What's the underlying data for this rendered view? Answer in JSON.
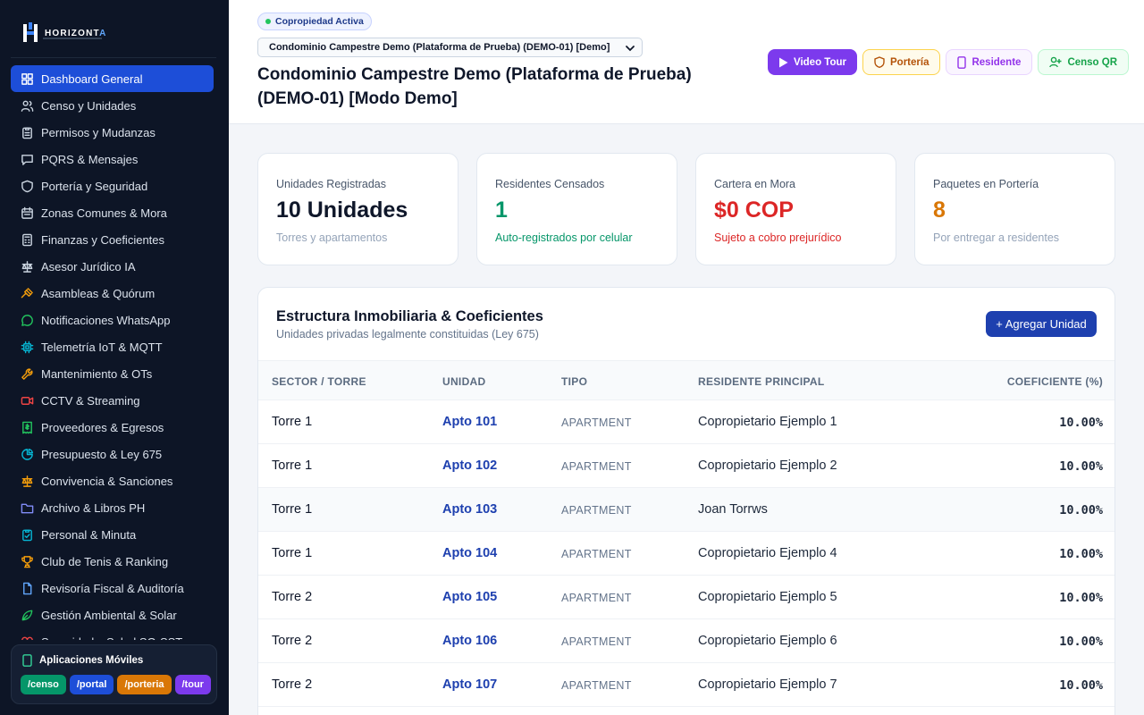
{
  "brand": {
    "name": "HORIZONT",
    "name_accent": "A"
  },
  "sidebar": {
    "items": [
      {
        "label": "Dashboard General",
        "icon": "dashboard-icon",
        "color": "#ffffff"
      },
      {
        "label": "Censo y Unidades",
        "icon": "users-icon",
        "color": "#cbd5e1"
      },
      {
        "label": "Permisos y Mudanzas",
        "icon": "clipboard-icon",
        "color": "#cbd5e1"
      },
      {
        "label": "PQRS & Mensajes",
        "icon": "message-icon",
        "color": "#cbd5e1"
      },
      {
        "label": "Portería y Seguridad",
        "icon": "shield-icon",
        "color": "#cbd5e1"
      },
      {
        "label": "Zonas Comunes & Mora",
        "icon": "calendar-icon",
        "color": "#cbd5e1"
      },
      {
        "label": "Finanzas y Coeficientes",
        "icon": "calculator-icon",
        "color": "#cbd5e1"
      },
      {
        "label": "Asesor Jurídico IA",
        "icon": "scale-icon",
        "color": "#cbd5e1"
      },
      {
        "label": "Asambleas & Quórum",
        "icon": "gavel-icon",
        "color": "#f59e0b"
      },
      {
        "label": "Notificaciones WhatsApp",
        "icon": "whatsapp-icon",
        "color": "#22c55e"
      },
      {
        "label": "Telemetría IoT & MQTT",
        "icon": "chip-icon",
        "color": "#06b6d4"
      },
      {
        "label": "Mantenimiento & OTs",
        "icon": "wrench-icon",
        "color": "#f59e0b"
      },
      {
        "label": "CCTV & Streaming",
        "icon": "video-icon",
        "color": "#ef4444"
      },
      {
        "label": "Proveedores & Egresos",
        "icon": "receipt-icon",
        "color": "#22c55e"
      },
      {
        "label": "Presupuesto & Ley 675",
        "icon": "pie-chart-icon",
        "color": "#06b6d4"
      },
      {
        "label": "Convivencia & Sanciones",
        "icon": "balance-icon",
        "color": "#f59e0b"
      },
      {
        "label": "Archivo & Libros PH",
        "icon": "folder-icon",
        "color": "#818cf8"
      },
      {
        "label": "Personal & Minuta",
        "icon": "clipboard-check-icon",
        "color": "#06b6d4"
      },
      {
        "label": "Club de Tenis & Ranking",
        "icon": "trophy-icon",
        "color": "#f59e0b"
      },
      {
        "label": "Revisoría Fiscal & Auditoría",
        "icon": "file-icon",
        "color": "#60a5fa"
      },
      {
        "label": "Gestión Ambiental & Solar",
        "icon": "leaf-icon",
        "color": "#22c55e"
      },
      {
        "label": "Seguridad y Salud SG-SST",
        "icon": "heart-icon",
        "color": "#ef4444"
      }
    ],
    "apps": {
      "title": "Aplicaciones Móviles",
      "links": [
        {
          "label": "/censo",
          "color": "#059669"
        },
        {
          "label": "/portal",
          "color": "#1d4ed8"
        },
        {
          "label": "/porteria",
          "color": "#d97706"
        },
        {
          "label": "/tour",
          "color": "#7c3aed"
        }
      ]
    }
  },
  "header": {
    "badge": "Copropiedad Activa",
    "selector_value": "Condominio Campestre Demo (Plataforma de Prueba) (DEMO-01) [Demo]",
    "title": "Condominio Campestre Demo (Plataforma de Prueba) (DEMO-01) [Modo Demo]",
    "buttons": {
      "tour": "Video Tour",
      "porteria": "Portería",
      "residente": "Residente",
      "censo": "Censo QR"
    }
  },
  "kpis": [
    {
      "label": "Unidades Registradas",
      "value": "10 Unidades",
      "sub": "Torres y apartamentos",
      "value_color": "#0f172a",
      "sub_color": "#94a3b8"
    },
    {
      "label": "Residentes Censados",
      "value": "1",
      "sub": "Auto-registrados por celular",
      "value_color": "#059669",
      "sub_color": "#059669"
    },
    {
      "label": "Cartera en Mora",
      "value": "$0 COP",
      "sub": "Sujeto a cobro prejurídico",
      "value_color": "#dc2626",
      "sub_color": "#dc2626"
    },
    {
      "label": "Paquetes en Portería",
      "value": "8",
      "sub": "Por entregar a residentes",
      "value_color": "#d97706",
      "sub_color": "#94a3b8"
    }
  ],
  "structure": {
    "title": "Estructura Inmobiliaria & Coeficientes",
    "subtitle": "Unidades privadas legalmente constituidas (Ley 675)",
    "add_button": "+ Agregar Unidad",
    "columns": [
      "SECTOR / TORRE",
      "UNIDAD",
      "TIPO",
      "RESIDENTE PRINCIPAL",
      "COEFICIENTE (%)"
    ],
    "rows": [
      {
        "sector": "Torre 1",
        "unit": "Apto 101",
        "type": "APARTMENT",
        "resident": "Copropietario Ejemplo 1",
        "coef": "10.00%"
      },
      {
        "sector": "Torre 1",
        "unit": "Apto 102",
        "type": "APARTMENT",
        "resident": "Copropietario Ejemplo 2",
        "coef": "10.00%"
      },
      {
        "sector": "Torre 1",
        "unit": "Apto 103",
        "type": "APARTMENT",
        "resident": "Joan Torrws",
        "coef": "10.00%"
      },
      {
        "sector": "Torre 1",
        "unit": "Apto 104",
        "type": "APARTMENT",
        "resident": "Copropietario Ejemplo 4",
        "coef": "10.00%"
      },
      {
        "sector": "Torre 2",
        "unit": "Apto 105",
        "type": "APARTMENT",
        "resident": "Copropietario Ejemplo 5",
        "coef": "10.00%"
      },
      {
        "sector": "Torre 2",
        "unit": "Apto 106",
        "type": "APARTMENT",
        "resident": "Copropietario Ejemplo 6",
        "coef": "10.00%"
      },
      {
        "sector": "Torre 2",
        "unit": "Apto 107",
        "type": "APARTMENT",
        "resident": "Copropietario Ejemplo 7",
        "coef": "10.00%"
      }
    ]
  }
}
